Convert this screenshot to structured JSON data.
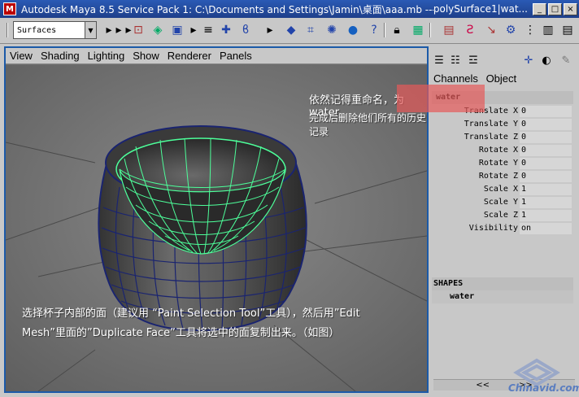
{
  "window": {
    "title": "Autodesk Maya 8.5 Service Pack 1: C:\\Documents and Settings\\Jamin\\桌面\\aaa.mb  ---",
    "title_extra": "polySurface1|wat...",
    "minimize_glyph": "_",
    "maximize_glyph": "□",
    "close_glyph": "×",
    "app_icon_glyph": "M"
  },
  "toolbar": {
    "menu_set": "Surfaces",
    "dropdown_glyph": "▼"
  },
  "panel_menu": [
    "View",
    "Shading",
    "Lighting",
    "Show",
    "Renderer",
    "Panels"
  ],
  "annotations": {
    "top_line1": "依然记得重命名，为water",
    "top_line2": "完成后删除他们所有的历史记录",
    "bottom_line1": "选择杯子内部的面（建议用 “Paint Selection Tool”工具），然后用”Edit",
    "bottom_line2": "Mesh”里面的”Duplicate Face”工具将选中的面复制出来。（如图）"
  },
  "channel_box": {
    "menu": [
      "Channels",
      "Object"
    ],
    "object_name": "water",
    "attributes": [
      {
        "label": "Translate X",
        "value": "0"
      },
      {
        "label": "Translate Y",
        "value": "0"
      },
      {
        "label": "Translate Z",
        "value": "0"
      },
      {
        "label": "Rotate X",
        "value": "0"
      },
      {
        "label": "Rotate Y",
        "value": "0"
      },
      {
        "label": "Rotate Z",
        "value": "0"
      },
      {
        "label": "Scale X",
        "value": "1"
      },
      {
        "label": "Scale Y",
        "value": "1"
      },
      {
        "label": "Scale Z",
        "value": "1"
      },
      {
        "label": "Visibility",
        "value": "on"
      }
    ],
    "shapes_header": "SHAPES",
    "shape_name": "water",
    "scroll_left": "<<",
    "scroll_right": ">>"
  },
  "watermark": {
    "text": "Chinavid.com"
  },
  "colors": {
    "title_bar": "#1e3f8a",
    "viewport_border": "#1c5aa8",
    "wire_selected": "#4dff9a",
    "mesh_wire": "#1a2470",
    "highlight": "#e65a5a"
  }
}
